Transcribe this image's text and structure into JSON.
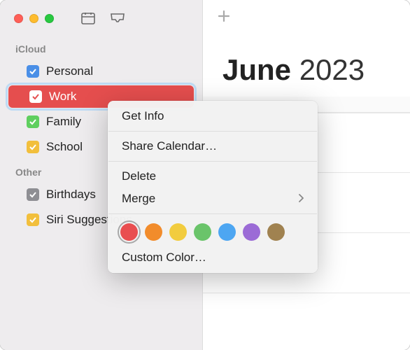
{
  "month": {
    "label": "June",
    "year": "2023"
  },
  "sections": [
    {
      "name": "iCloud",
      "items": [
        {
          "label": "Personal",
          "color": "#4A8FE7"
        },
        {
          "label": "Work",
          "color": "#E54E4E",
          "selected": true
        },
        {
          "label": "Family",
          "color": "#5FCF5F"
        },
        {
          "label": "School",
          "color": "#F2BF3C"
        }
      ]
    },
    {
      "name": "Other",
      "items": [
        {
          "label": "Birthdays",
          "color": "#8E8E93"
        },
        {
          "label": "Siri Suggestions",
          "color": "#F2BF3C"
        }
      ]
    }
  ],
  "menu": {
    "getInfo": "Get Info",
    "share": "Share Calendar…",
    "delete": "Delete",
    "merge": "Merge",
    "customColor": "Custom Color…"
  },
  "colors": [
    "#E94E50",
    "#F28C2B",
    "#F2CC3E",
    "#6AC46A",
    "#4DA6F2",
    "#9B6BD6",
    "#A08250"
  ]
}
